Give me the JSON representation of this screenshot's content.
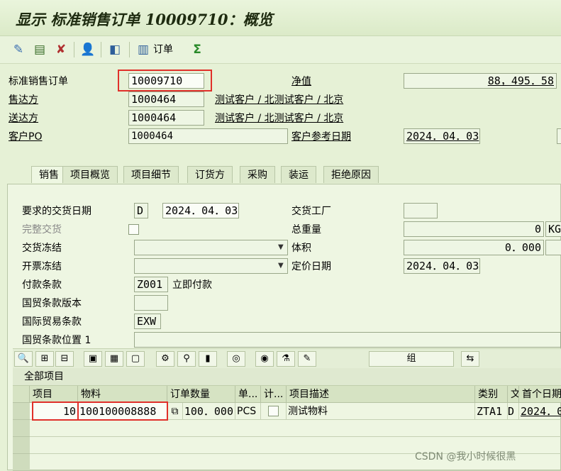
{
  "title": "显示 标准销售订单 10009710：概览",
  "toolbar": {
    "order_label": "订单",
    "icons": [
      "display-change-icon",
      "document-icon",
      "check-cancel-icon",
      "person-icon",
      "document-flow-icon",
      "order-icon",
      "sum-icon"
    ]
  },
  "header": {
    "order_type_label": "标准销售订单",
    "order_number": "10009710",
    "net_value_label": "净值",
    "net_value": "88，495．58",
    "sold_to_label": "售达方",
    "sold_to": "1000464",
    "sold_to_desc": "测试客户 / 北测试客户 / 北京",
    "ship_to_label": "送达方",
    "ship_to": "1000464",
    "ship_to_desc": "测试客户 / 北测试客户 / 北京",
    "customer_po_label": "客户PO",
    "customer_po": "1000464",
    "cust_ref_date_label": "客户参考日期",
    "cust_ref_date": "2024．04．03"
  },
  "tabs": [
    "销售",
    "项目概览",
    "项目细节",
    "订货方",
    "采购",
    "装运",
    "拒绝原因"
  ],
  "sales": {
    "req_delivery_date_label": "要求的交货日期",
    "req_delivery_date_type": "D",
    "req_delivery_date": "2024．04．03",
    "delivery_plant_label": "交货工厂",
    "complete_delivery_label": "完整交货",
    "total_weight_label": "总重量",
    "total_weight": "0",
    "weight_unit": "KG",
    "delivery_block_label": "交货冻结",
    "volume_label": "体积",
    "volume": "0．000",
    "billing_block_label": "开票冻结",
    "pricing_date_label": "定价日期",
    "pricing_date": "2024．04．03",
    "payment_terms_label": "付款条款",
    "payment_terms": "Z001",
    "payment_terms_desc": "立即付款",
    "incoterms_version_label": "国贸条款版本",
    "incoterms_label": "国际贸易条款",
    "incoterms": "EXW",
    "incoterms_location_label": "国贸条款位置 1"
  },
  "items_toolbar": {
    "group_label": "组"
  },
  "items": {
    "title": "全部项目",
    "columns": [
      "项目",
      "物料",
      "订单数量",
      "单...",
      "计...",
      "项目描述",
      "类别",
      "文",
      "首个日期"
    ],
    "rows": [
      {
        "item": "10",
        "material": "100100008888",
        "quantity": "100．000",
        "unit": "PCS",
        "description": "测试物料",
        "category": "ZTA1",
        "date_type": "D",
        "first_date": "2024．0"
      }
    ]
  },
  "watermark": "CSDN @我小时候很黑",
  "colors": {
    "background": "#e6f1d6",
    "highlight_red": "#e0302a"
  }
}
